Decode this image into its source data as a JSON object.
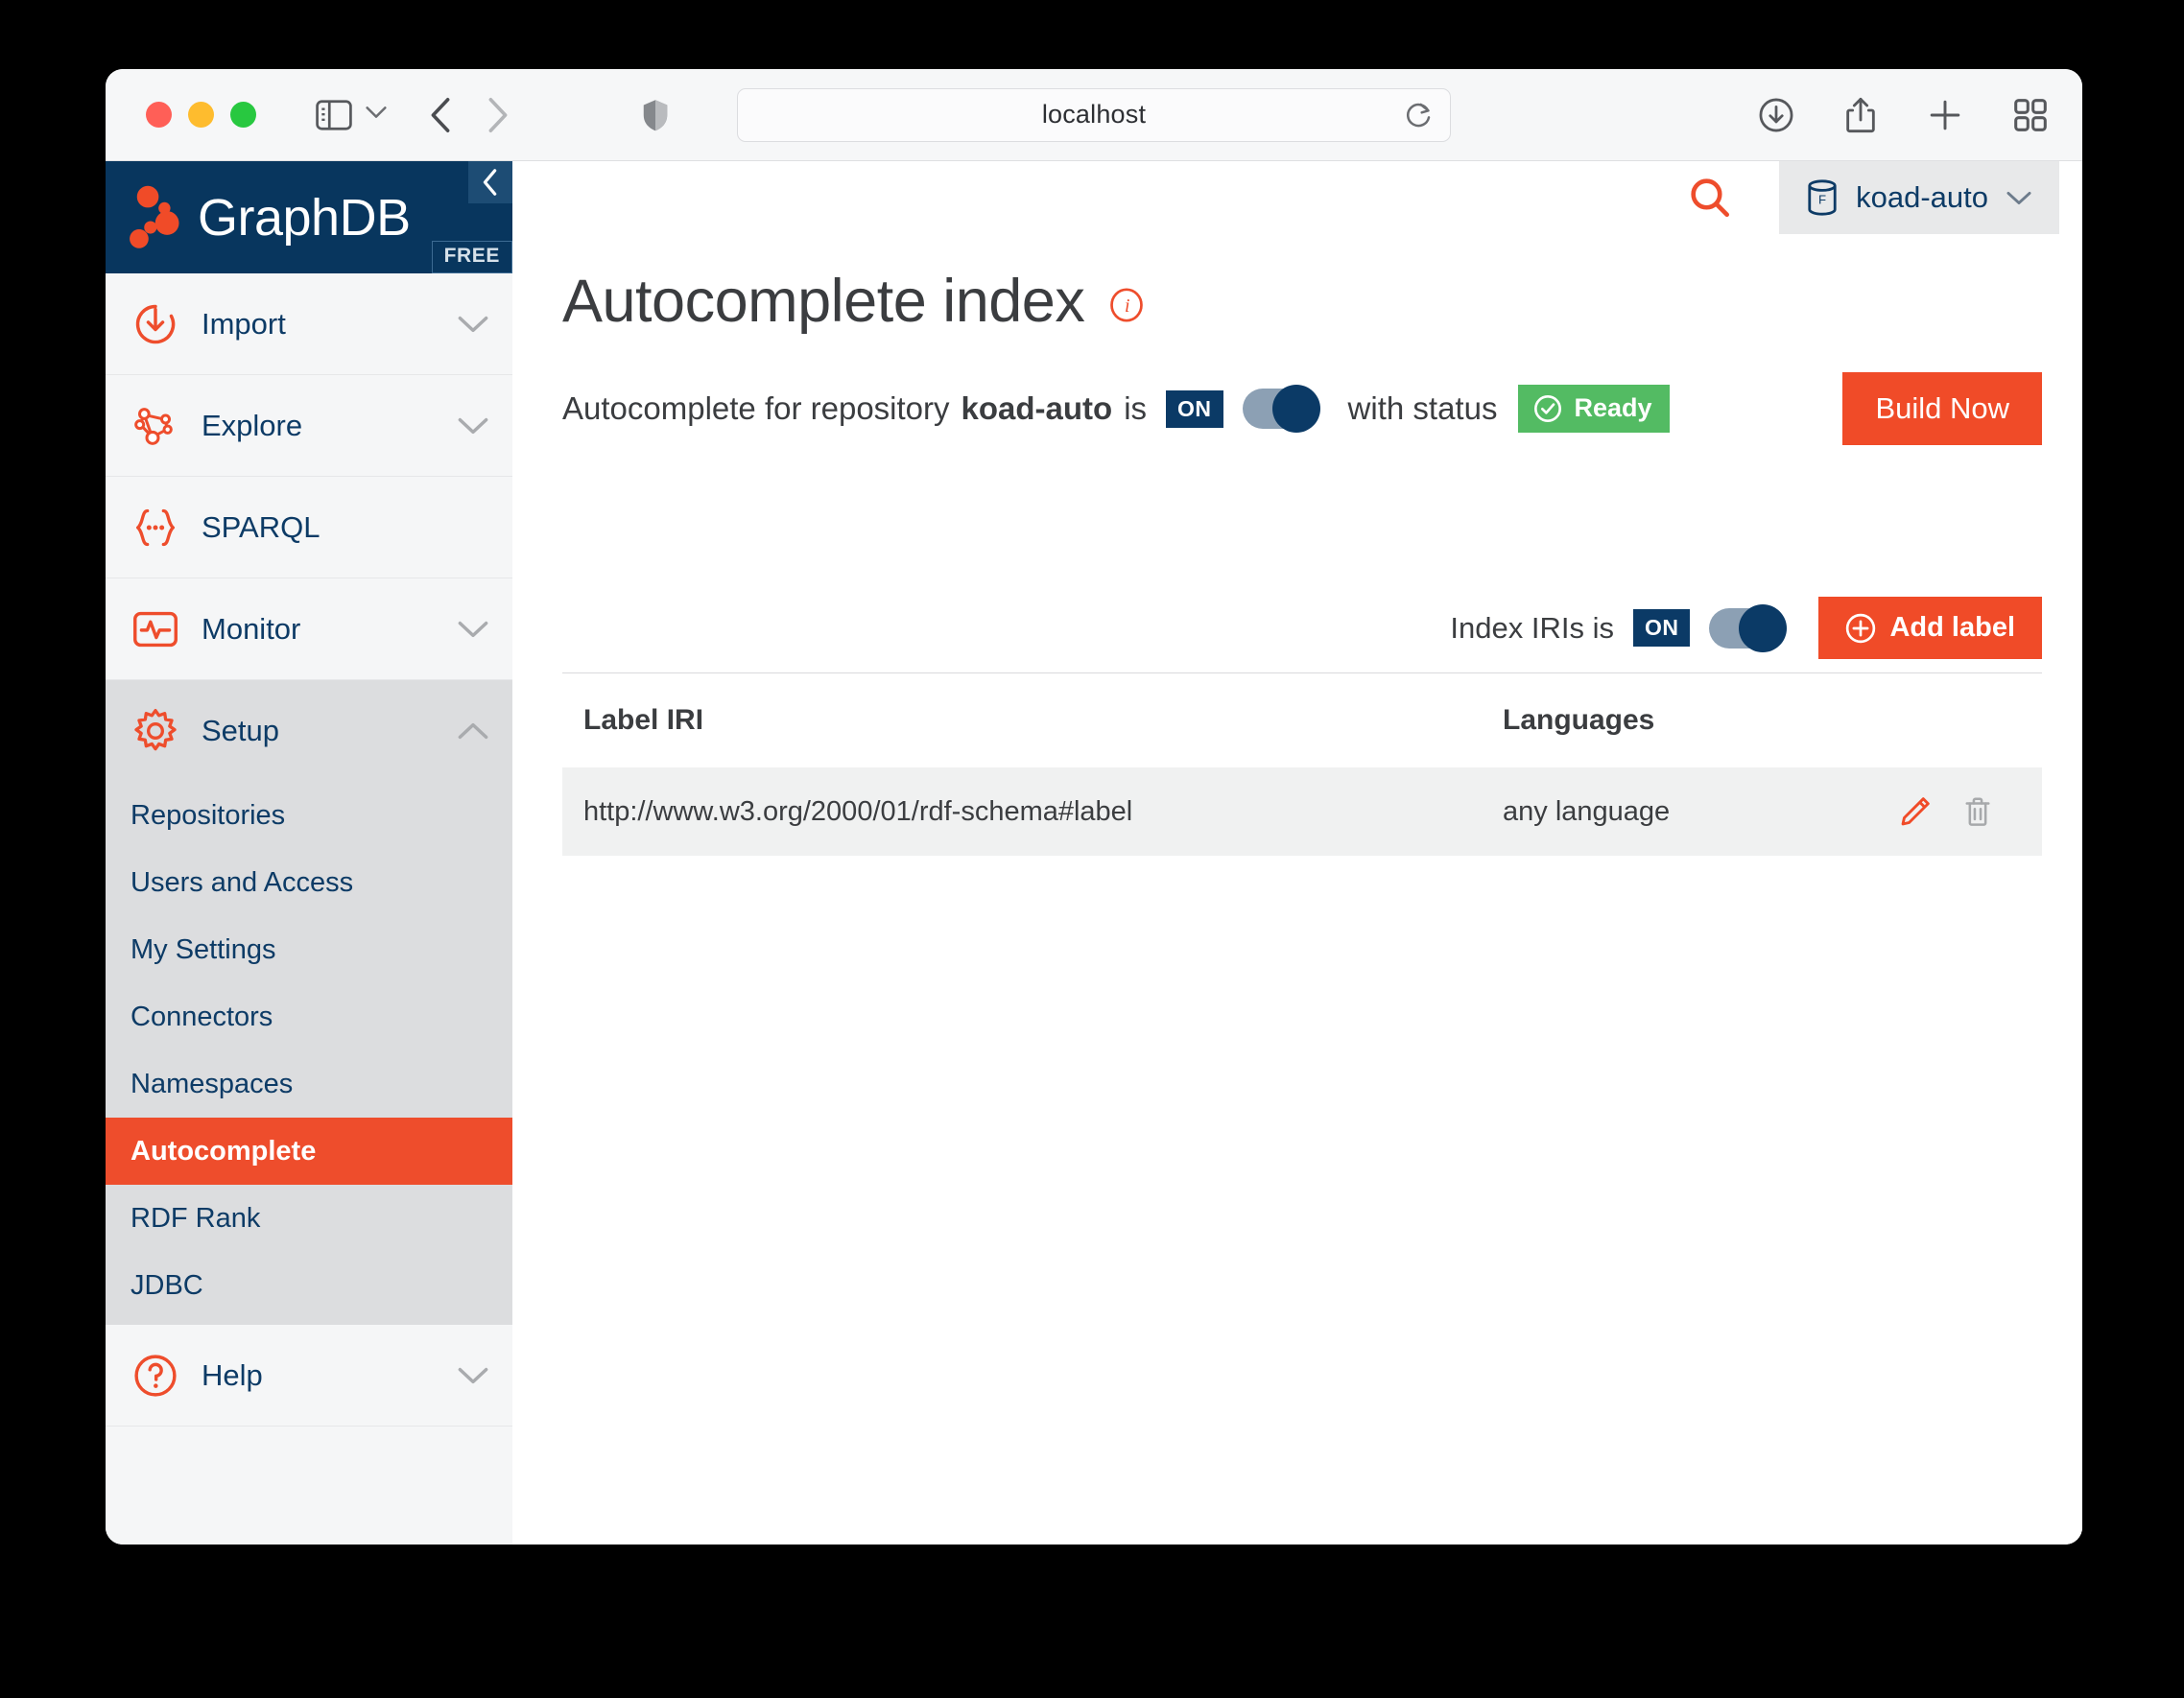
{
  "browser": {
    "url": "localhost",
    "icons": {
      "sidebar_toggle": "sidebar-icon",
      "tab_overview_chevron": "chevron-down-icon",
      "back": "chevron-left-icon",
      "forward": "chevron-right-icon",
      "shield": "shield-icon",
      "reload": "reload-icon",
      "downloads": "download-icon",
      "share": "share-icon",
      "new_tab": "plus-icon",
      "tab_overview": "grid-icon"
    }
  },
  "sidebar": {
    "brand": {
      "name": "GraphDB",
      "edition_badge": "FREE",
      "collapse_label": "Collapse"
    },
    "items": [
      {
        "label": "Import",
        "icon": "import-icon",
        "expandable": true,
        "expanded": false
      },
      {
        "label": "Explore",
        "icon": "explore-graph-icon",
        "expandable": true,
        "expanded": false
      },
      {
        "label": "SPARQL",
        "icon": "sparql-braces-icon",
        "expandable": false,
        "expanded": false
      },
      {
        "label": "Monitor",
        "icon": "monitor-pulse-icon",
        "expandable": true,
        "expanded": false
      },
      {
        "label": "Setup",
        "icon": "gear-icon",
        "expandable": true,
        "expanded": true
      },
      {
        "label": "Help",
        "icon": "help-question-icon",
        "expandable": true,
        "expanded": false
      }
    ],
    "setup_subitems": [
      {
        "label": "Repositories",
        "active": false
      },
      {
        "label": "Users and Access",
        "active": false
      },
      {
        "label": "My Settings",
        "active": false
      },
      {
        "label": "Connectors",
        "active": false
      },
      {
        "label": "Namespaces",
        "active": false
      },
      {
        "label": "Autocomplete",
        "active": true
      },
      {
        "label": "RDF Rank",
        "active": false
      },
      {
        "label": "JDBC",
        "active": false
      }
    ]
  },
  "header": {
    "search_label": "Search",
    "repository": "koad-auto",
    "repository_icon": "database-free-icon"
  },
  "page": {
    "title": "Autocomplete index",
    "info_tooltip": "info",
    "status_prefix": "Autocomplete for repository",
    "repository": "koad-auto",
    "status_is": "is",
    "toggle_state": "ON",
    "with_status_label": "with status",
    "status_value": "Ready",
    "build_button": "Build Now"
  },
  "controls": {
    "index_iris_label": "Index IRIs is",
    "index_iris_state": "ON",
    "add_label_button": "Add label"
  },
  "table": {
    "columns": [
      "Label IRI",
      "Languages"
    ],
    "rows": [
      {
        "label_iri": "http://www.w3.org/2000/01/rdf-schema#label",
        "languages": "any language",
        "edit_icon": "pencil-icon",
        "delete_icon": "trash-icon"
      }
    ]
  },
  "colors": {
    "brand_navy": "#08365e",
    "accent_orange": "#f04b28",
    "status_green": "#53bb63",
    "toggle_track": "#8ca0b4",
    "toggle_knob": "#0b3a66"
  }
}
